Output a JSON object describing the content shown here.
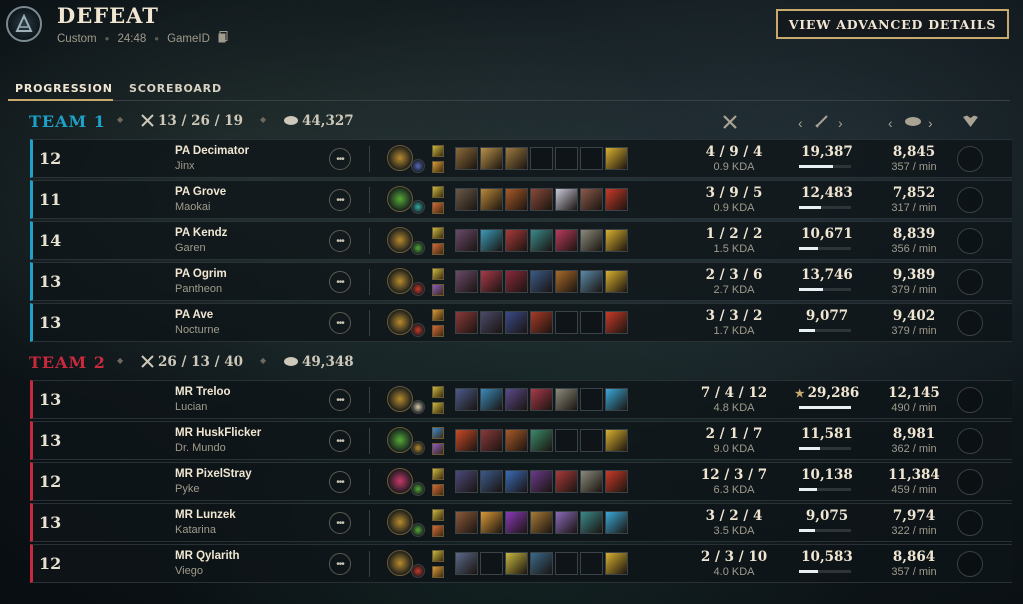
{
  "header": {
    "title": "DEFEAT",
    "mode": "Custom",
    "duration": "24:48",
    "game_id_label": "GameID",
    "advanced_button": "VIEW ADVANCED DETAILS"
  },
  "tabs": [
    {
      "label": "PROGRESSION",
      "active": true
    },
    {
      "label": "SCOREBOARD",
      "active": false
    }
  ],
  "colors": {
    "team1": "#1fa0c8",
    "team2": "#c8293c",
    "gold_accent": "#c8aa6e"
  },
  "column_icons": [
    "kda-swords-icon",
    "damage-sword-icon",
    "gold-coins-icon",
    "honor-heart-icon"
  ],
  "teams": [
    {
      "name": "TEAM 1",
      "kda": "13 / 26 / 19",
      "gold": "44,327",
      "players": [
        {
          "level": "12",
          "name": "PA Decimator",
          "champion": "Jinx",
          "kda": "4 / 9 / 4",
          "kda_ratio": "0.9 KDA",
          "damage": "19,387",
          "damage_fraction": 0.66,
          "top_damage": false,
          "gold": "8,845",
          "gpm": "357 / min",
          "keystone": "#b88a2e",
          "secondary": "#5a6ab8",
          "spells": [
            "#c8b840",
            "#d89838"
          ],
          "items": [
            "#8a6a3a",
            "#b89048",
            "#9a7a40",
            "",
            "",
            "",
            "#d8b030"
          ]
        },
        {
          "level": "11",
          "name": "PA Grove",
          "champion": "Maokai",
          "kda": "3 / 9 / 5",
          "kda_ratio": "0.9 KDA",
          "damage": "12,483",
          "damage_fraction": 0.43,
          "top_damage": false,
          "gold": "7,852",
          "gpm": "317 / min",
          "keystone": "#58a838",
          "secondary": "#3aa8a0",
          "spells": [
            "#c8b840",
            "#d86838"
          ],
          "items": [
            "#6a5a48",
            "#b88838",
            "#a85a28",
            "#8a4a3a",
            "#c8c8d8",
            "#8a5a4a",
            "#c83a28"
          ]
        },
        {
          "level": "14",
          "name": "PA Kendz",
          "champion": "Garen",
          "kda": "1 / 2 / 2",
          "kda_ratio": "1.5 KDA",
          "damage": "10,671",
          "damage_fraction": 0.37,
          "top_damage": false,
          "gold": "8,839",
          "gpm": "356 / min",
          "keystone": "#b88a2e",
          "secondary": "#58a838",
          "spells": [
            "#c8b840",
            "#d86838"
          ],
          "items": [
            "#6a4a6a",
            "#3a9ab8",
            "#a83a3a",
            "#3a8a8a",
            "#b83a5a",
            "#8a8a7a",
            "#d8b030"
          ]
        },
        {
          "level": "13",
          "name": "PA Ogrim",
          "champion": "Pantheon",
          "kda": "2 / 3 / 6",
          "kda_ratio": "2.7 KDA",
          "damage": "13,746",
          "damage_fraction": 0.47,
          "top_damage": false,
          "gold": "9,389",
          "gpm": "379 / min",
          "keystone": "#b88a2e",
          "secondary": "#c83a28",
          "spells": [
            "#c8b840",
            "#8a5ac8"
          ],
          "items": [
            "#6a4a6a",
            "#a83a4a",
            "#8a2a3a",
            "#3a5a8a",
            "#a86a28",
            "#5a8aa8",
            "#d8b030"
          ]
        },
        {
          "level": "13",
          "name": "PA Ave",
          "champion": "Nocturne",
          "kda": "3 / 3 / 2",
          "kda_ratio": "1.7 KDA",
          "damage": "9,077",
          "damage_fraction": 0.31,
          "top_damage": false,
          "gold": "9,402",
          "gpm": "379 / min",
          "keystone": "#b88a2e",
          "secondary": "#c83a28",
          "spells": [
            "#d89838",
            "#d86838"
          ],
          "items": [
            "#8a3a3a",
            "#4a4a6a",
            "#3a4a8a",
            "#a83a28",
            "",
            "",
            "#c83a28"
          ]
        }
      ]
    },
    {
      "name": "TEAM 2",
      "kda": "26 / 13 / 40",
      "gold": "49,348",
      "players": [
        {
          "level": "13",
          "name": "MR Treloo",
          "champion": "Lucian",
          "kda": "7 / 4 / 12",
          "kda_ratio": "4.8 KDA",
          "damage": "29,286",
          "damage_fraction": 1.0,
          "top_damage": true,
          "gold": "12,145",
          "gpm": "490 / min",
          "keystone": "#b88a2e",
          "secondary": "#d8c8a8",
          "spells": [
            "#c8b840",
            "#c8b840"
          ],
          "items": [
            "#4a5a8a",
            "#3a8ab8",
            "#5a4a8a",
            "#a83a4a",
            "#8a8a7a",
            "",
            "#3aa8d8"
          ]
        },
        {
          "level": "13",
          "name": "MR HuskFlicker",
          "champion": "Dr. Mundo",
          "kda": "2 / 1 / 7",
          "kda_ratio": "9.0 KDA",
          "damage": "11,581",
          "damage_fraction": 0.4,
          "top_damage": false,
          "gold": "8,981",
          "gpm": "362 / min",
          "keystone": "#58a838",
          "secondary": "#b88a2e",
          "spells": [
            "#3a8ad8",
            "#8a5ac8"
          ],
          "items": [
            "#c84a28",
            "#8a3a3a",
            "#a85a28",
            "#3a8a6a",
            "",
            "",
            "#d8b030"
          ]
        },
        {
          "level": "12",
          "name": "MR PixelStray",
          "champion": "Pyke",
          "kda": "12 / 3 / 7",
          "kda_ratio": "6.3 KDA",
          "damage": "10,138",
          "damage_fraction": 0.35,
          "top_damage": false,
          "gold": "11,384",
          "gpm": "459 / min",
          "keystone": "#c83a6a",
          "secondary": "#58a838",
          "spells": [
            "#c8b840",
            "#d86838"
          ],
          "items": [
            "#4a4a7a",
            "#3a5a8a",
            "#3a6ab8",
            "#6a3a8a",
            "#a83a3a",
            "#8a8a7a",
            "#c83a28"
          ]
        },
        {
          "level": "13",
          "name": "MR Lunzek",
          "champion": "Katarina",
          "kda": "3 / 2 / 4",
          "kda_ratio": "3.5 KDA",
          "damage": "9,075",
          "damage_fraction": 0.31,
          "top_damage": false,
          "gold": "7,974",
          "gpm": "322 / min",
          "keystone": "#b88a2e",
          "secondary": "#58a838",
          "spells": [
            "#c8b840",
            "#d86838"
          ],
          "items": [
            "#8a5a3a",
            "#d89838",
            "#8a3ab8",
            "#a87a38",
            "#8a6ab8",
            "#3a8a8a",
            "#3aa8d8"
          ]
        },
        {
          "level": "12",
          "name": "MR Qylarith",
          "champion": "Viego",
          "kda": "2 / 3 / 10",
          "kda_ratio": "4.0 KDA",
          "damage": "10,583",
          "damage_fraction": 0.36,
          "top_damage": false,
          "gold": "8,864",
          "gpm": "357 / min",
          "keystone": "#b88a2e",
          "secondary": "#c83a28",
          "spells": [
            "#c8b840",
            "#d89838"
          ],
          "items": [
            "#5a6a8a",
            "",
            "#c8b840",
            "#3a6a8a",
            "",
            "",
            "#d8b030"
          ]
        }
      ]
    }
  ]
}
